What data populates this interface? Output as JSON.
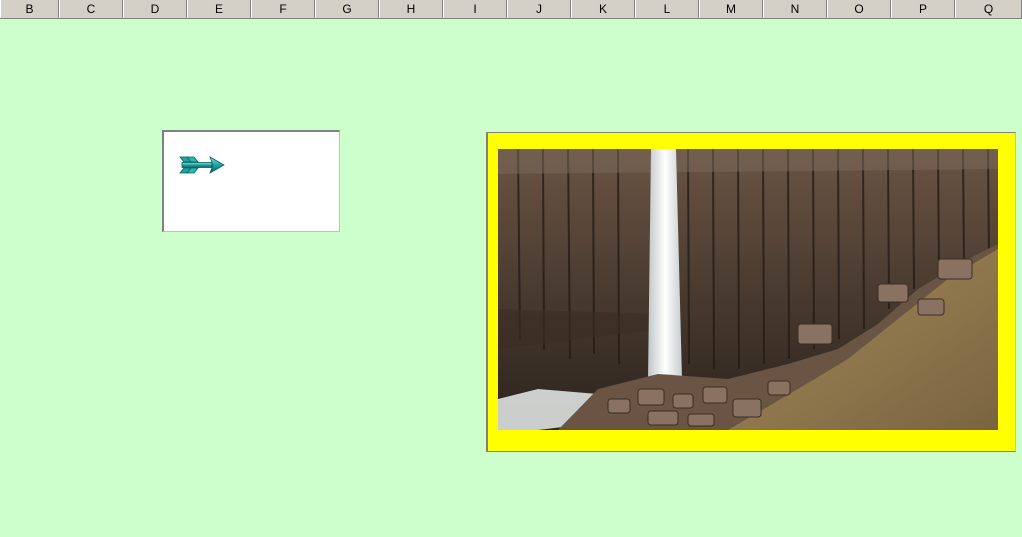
{
  "column_headers": [
    "B",
    "C",
    "D",
    "E",
    "F",
    "G",
    "H",
    "I",
    "J",
    "K",
    "L",
    "M",
    "N",
    "O",
    "P",
    "Q"
  ],
  "colors": {
    "sheet_background": "#ccffcc",
    "header_background": "#d4d0c8",
    "frame_fill": "#ffff00",
    "arrow_color": "#1fa3a3"
  },
  "text_box": {
    "icon": "arrow-right-icon"
  },
  "picture": {
    "subject": "waterfall-photo-icon"
  }
}
